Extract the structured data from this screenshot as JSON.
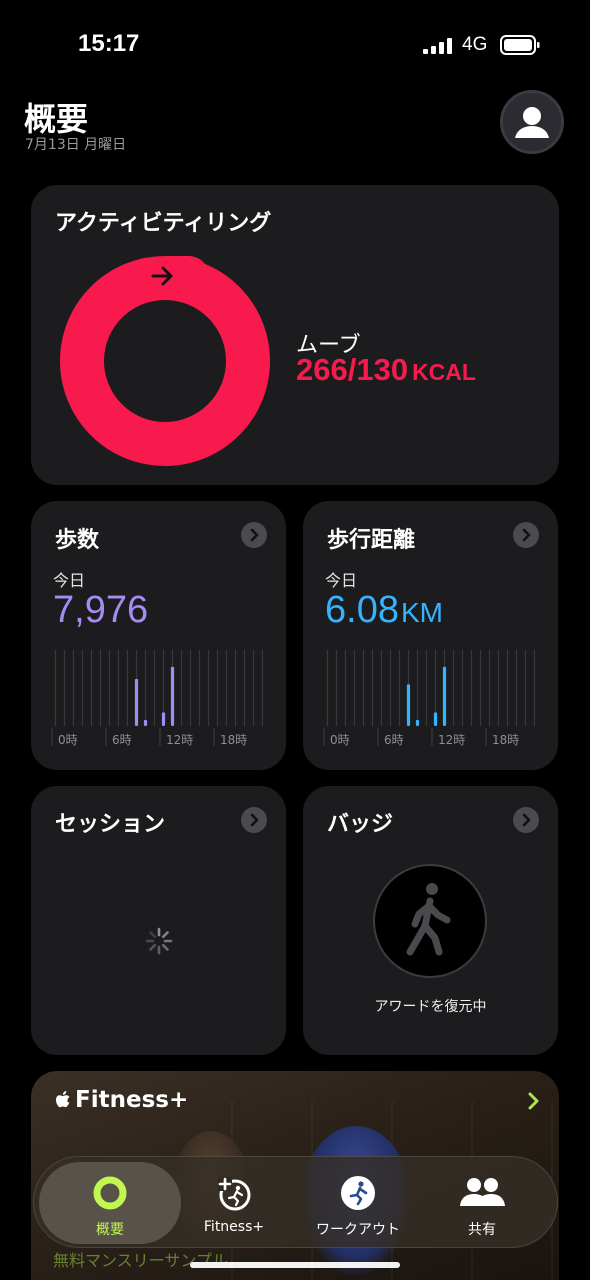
{
  "status_bar": {
    "time": "15:17",
    "network": "4G"
  },
  "header": {
    "title": "概要",
    "date": "7月13日 月曜日"
  },
  "activity": {
    "title": "アクティビティリング",
    "move_label": "ムーブ",
    "move_value": "266/130",
    "move_unit": "KCAL",
    "move_progress_fraction": 2.05,
    "ring_color": "#f81a4d"
  },
  "steps": {
    "title": "歩数",
    "today_label": "今日",
    "value": "7,976",
    "value_color": "#a48cf2",
    "axis_labels": [
      "0時",
      "6時",
      "12時",
      "18時"
    ],
    "highlight_bars": [
      {
        "hour": 9,
        "level": 0.62
      },
      {
        "hour": 10,
        "level": 0.08
      },
      {
        "hour": 12,
        "level": 0.18
      },
      {
        "hour": 13,
        "level": 0.78
      }
    ]
  },
  "distance": {
    "title": "歩行距離",
    "today_label": "今日",
    "value": "6.08",
    "unit": "KM",
    "value_color": "#35b3ff",
    "axis_labels": [
      "0時",
      "6時",
      "12時",
      "18時"
    ],
    "highlight_bars": [
      {
        "hour": 9,
        "level": 0.55
      },
      {
        "hour": 10,
        "level": 0.08
      },
      {
        "hour": 12,
        "level": 0.18
      },
      {
        "hour": 13,
        "level": 0.78
      }
    ]
  },
  "session": {
    "title": "セッション"
  },
  "badge": {
    "title": "バッジ",
    "caption": "アワードを復元中"
  },
  "promo": {
    "brand": "Fitness+",
    "subtitle": "無料マンスリーサンプル"
  },
  "tabs": [
    {
      "label": "概要",
      "icon": "activity-ring-icon",
      "active": true
    },
    {
      "label": "Fitness+",
      "icon": "fitness-plus-icon",
      "active": false
    },
    {
      "label": "ワークアウト",
      "icon": "workout-runner-icon",
      "active": false
    },
    {
      "label": "共有",
      "icon": "sharing-people-icon",
      "active": false
    }
  ],
  "colors": {
    "accent_green": "#c2f84e",
    "move_red": "#f81a4d",
    "steps_purple": "#a48cf2",
    "distance_blue": "#35b3ff"
  }
}
